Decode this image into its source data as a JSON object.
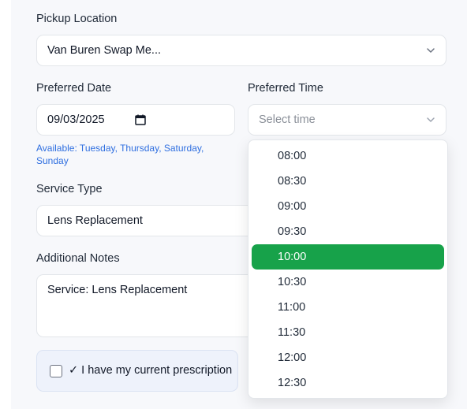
{
  "pickup": {
    "label": "Pickup Location",
    "value": "Van Buren Swap Me..."
  },
  "date": {
    "label": "Preferred Date",
    "value": "09/03/2025",
    "availability": "Available: Tuesday, Thursday, Saturday, Sunday"
  },
  "time": {
    "label": "Preferred Time",
    "placeholder": "Select time",
    "options": [
      "08:00",
      "08:30",
      "09:00",
      "09:30",
      "10:00",
      "10:30",
      "11:00",
      "11:30",
      "12:00",
      "12:30"
    ],
    "highlighted": "10:00"
  },
  "service": {
    "label": "Service Type",
    "value": "Lens Replacement"
  },
  "notes": {
    "label": "Additional Notes",
    "value": "Service: Lens Replacement"
  },
  "prescription": {
    "label": "✓ I have my current prescription",
    "checked": false
  },
  "colors": {
    "accent": "#17a24a",
    "hint": "#2f6fe0"
  }
}
